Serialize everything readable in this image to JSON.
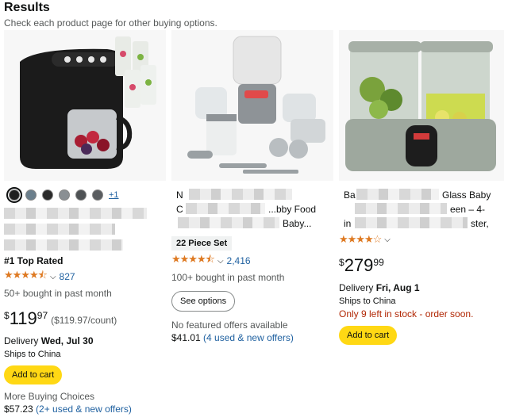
{
  "header": {
    "title": "Results",
    "subtitle": "Check each product page for other buying options."
  },
  "products": [
    {
      "swatches": [
        "#1f1f1f",
        "#6b7f8c",
        "#2a2a2a",
        "#8a8f93",
        "#4e5254",
        "#5a5d60"
      ],
      "swatch_more": "+1",
      "badge": "#1 Top Rated",
      "stars": "★★★★⯪",
      "review_count": "827",
      "bought": "50+ bought in past month",
      "price_currency": "$",
      "price_whole": "119",
      "price_fraction": "97",
      "unit_price": "($119.97/count)",
      "delivery_label": "Delivery",
      "delivery_date": "Wed, Jul 30",
      "ships": "Ships to China",
      "add_to_cart": "Add to cart",
      "more_choices": "More Buying Choices",
      "offer_price": "$57.23",
      "offer_link": "(2+ used & new offers)"
    },
    {
      "title_fragment_1": "N",
      "title_fragment_2": "C",
      "title_fragment_3": "...bby Food",
      "title_fragment_4": "Baby...",
      "piece_set": "22 Piece Set",
      "stars": "★★★★⯪",
      "review_count": "2,416",
      "bought": "100+ bought in past month",
      "see_options": "See options",
      "no_offers": "No featured offers available",
      "offer_price": "$41.01",
      "offer_link": "(4 used & new offers)"
    },
    {
      "title_fragment_1": "Ba",
      "title_fragment_2": "Glass Baby",
      "title_fragment_3": "een – 4-",
      "title_fragment_4": "in",
      "title_fragment_5": "ster,",
      "stars": "★★★★☆",
      "price_currency": "$",
      "price_whole": "279",
      "price_fraction": "99",
      "delivery_label": "Delivery",
      "delivery_date": "Fri, Aug 1",
      "ships": "Ships to China",
      "stock": "Only 9 left in stock - order soon.",
      "add_to_cart": "Add to cart"
    }
  ]
}
